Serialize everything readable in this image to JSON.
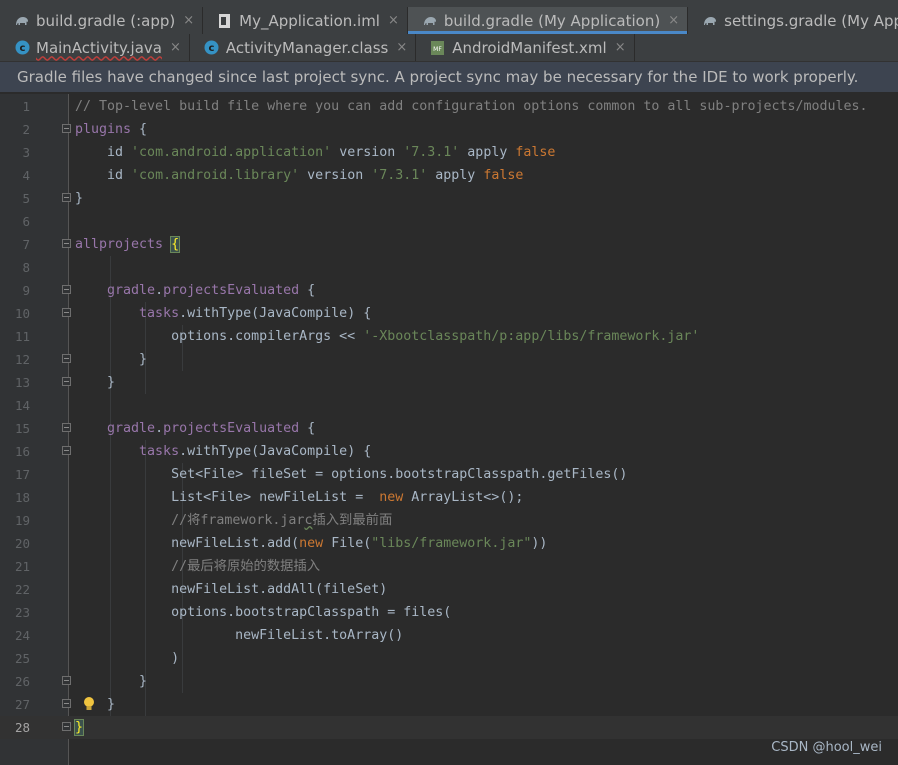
{
  "tabs_row1": [
    {
      "label": "build.gradle (:app)",
      "icon": "gradle-elephant-icon",
      "active": false
    },
    {
      "label": "My_Application.iml",
      "icon": "iml-file-icon",
      "active": false
    },
    {
      "label": "build.gradle (My Application)",
      "icon": "gradle-elephant-icon",
      "active": true
    },
    {
      "label": "settings.gradle (My Application)",
      "icon": "gradle-elephant-icon",
      "active": false
    },
    {
      "label": "",
      "icon": "chart-file-icon",
      "active": false
    }
  ],
  "tabs_row2": [
    {
      "label": "MainActivity.java",
      "icon": "class-c-icon",
      "active": false
    },
    {
      "label": "ActivityManager.class",
      "icon": "class-c-icon",
      "active": false
    },
    {
      "label": "AndroidManifest.xml",
      "icon": "manifest-icon",
      "active": false
    }
  ],
  "tab_close_glyph": "×",
  "banner": {
    "text": "Gradle files have changed since last project sync. A project sync may be necessary for the IDE to work properly."
  },
  "colors": {
    "keyword": "#cc7832",
    "string": "#6a8759",
    "comment": "#808080",
    "property": "#9876aa",
    "plain": "#a9b7c6"
  },
  "code": [
    {
      "n": "1",
      "segs": [
        [
          "comment",
          "// Top-level build file where you can add configuration options common to all sub-projects/modules."
        ]
      ]
    },
    {
      "n": "2",
      "segs": [
        [
          "property",
          "plugins"
        ],
        [
          "plain",
          " {"
        ]
      ]
    },
    {
      "n": "3",
      "segs": [
        [
          "plain",
          "    id "
        ],
        [
          "string",
          "'com.android.application'"
        ],
        [
          "plain",
          " version "
        ],
        [
          "string",
          "'7.3.1'"
        ],
        [
          "plain",
          " apply "
        ],
        [
          "keyword",
          "false"
        ]
      ]
    },
    {
      "n": "4",
      "segs": [
        [
          "plain",
          "    id "
        ],
        [
          "string",
          "'com.android.library'"
        ],
        [
          "plain",
          " version "
        ],
        [
          "string",
          "'7.3.1'"
        ],
        [
          "plain",
          " apply "
        ],
        [
          "keyword",
          "false"
        ]
      ]
    },
    {
      "n": "5",
      "segs": [
        [
          "plain",
          "}"
        ]
      ]
    },
    {
      "n": "6",
      "segs": []
    },
    {
      "n": "7",
      "segs": [
        [
          "property",
          "allprojects"
        ],
        [
          "plain",
          " "
        ],
        [
          "brace",
          "{"
        ]
      ]
    },
    {
      "n": "8",
      "segs": []
    },
    {
      "n": "9",
      "segs": [
        [
          "property",
          "    gradle"
        ],
        [
          "plain",
          "."
        ],
        [
          "property",
          "projectsEvaluated"
        ],
        [
          "plain",
          " {"
        ]
      ]
    },
    {
      "n": "10",
      "segs": [
        [
          "property",
          "        tasks"
        ],
        [
          "plain",
          ".withType(JavaCompile) {"
        ]
      ]
    },
    {
      "n": "11",
      "segs": [
        [
          "plain",
          "            options.compilerArgs << "
        ],
        [
          "string",
          "'-Xbootclasspath/p:app/libs/framework.jar'"
        ]
      ]
    },
    {
      "n": "12",
      "segs": [
        [
          "plain",
          "        }"
        ]
      ]
    },
    {
      "n": "13",
      "segs": [
        [
          "plain",
          "    }"
        ]
      ]
    },
    {
      "n": "14",
      "segs": []
    },
    {
      "n": "15",
      "segs": [
        [
          "property",
          "    gradle"
        ],
        [
          "plain",
          "."
        ],
        [
          "property",
          "projectsEvaluated"
        ],
        [
          "plain",
          " {"
        ]
      ]
    },
    {
      "n": "16",
      "segs": [
        [
          "property",
          "        tasks"
        ],
        [
          "plain",
          ".withType(JavaCompile) {"
        ]
      ]
    },
    {
      "n": "17",
      "segs": [
        [
          "plain",
          "            Set<File> fileSet = options.bootstrapClasspath.getFiles()"
        ]
      ]
    },
    {
      "n": "18",
      "segs": [
        [
          "plain",
          "            List<File> newFileList =  "
        ],
        [
          "keyword",
          "new"
        ],
        [
          "plain",
          " ArrayList<>();"
        ]
      ]
    },
    {
      "n": "19",
      "segs": [
        [
          "comment",
          "            //将framework.jar"
        ],
        [
          "commentwavy",
          "c"
        ],
        [
          "comment",
          "插入到最前面"
        ]
      ]
    },
    {
      "n": "20",
      "segs": [
        [
          "plain",
          "            newFileList.add("
        ],
        [
          "keyword",
          "new"
        ],
        [
          "plain",
          " File("
        ],
        [
          "string",
          "\"libs/framework.jar\""
        ],
        [
          "plain",
          "))"
        ]
      ]
    },
    {
      "n": "21",
      "segs": [
        [
          "comment",
          "            //最后将原始的数据插入"
        ]
      ]
    },
    {
      "n": "22",
      "segs": [
        [
          "plain",
          "            newFileList.addAll(fileSet)"
        ]
      ]
    },
    {
      "n": "23",
      "segs": [
        [
          "plain",
          "            options.bootstrapClasspath = files("
        ]
      ]
    },
    {
      "n": "24",
      "segs": [
        [
          "plain",
          "                    newFileList.toArray()"
        ]
      ]
    },
    {
      "n": "25",
      "segs": [
        [
          "plain",
          "            )"
        ]
      ]
    },
    {
      "n": "26",
      "segs": [
        [
          "plain",
          "        }"
        ]
      ]
    },
    {
      "n": "27",
      "segs": [
        [
          "plain",
          "    }"
        ]
      ]
    },
    {
      "n": "28",
      "segs": [
        [
          "brace",
          "}"
        ]
      ]
    }
  ],
  "current_line": "28",
  "watermark": "CSDN @hool_wei"
}
